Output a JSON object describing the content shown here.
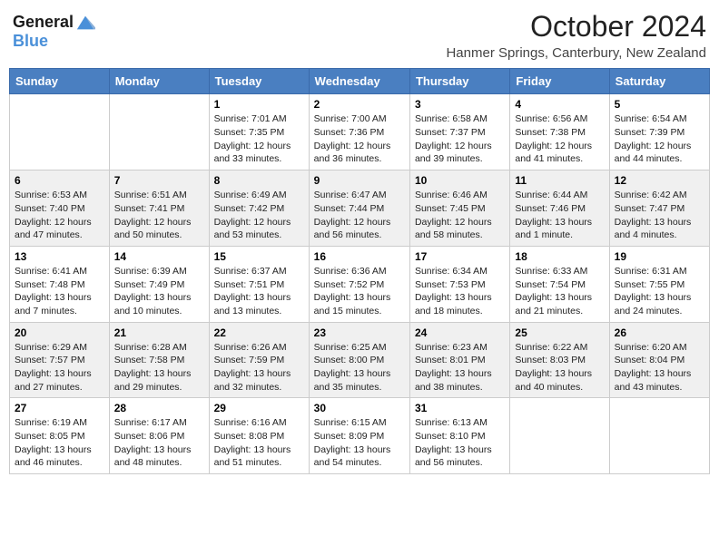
{
  "logo": {
    "general": "General",
    "blue": "Blue"
  },
  "title": "October 2024",
  "subtitle": "Hanmer Springs, Canterbury, New Zealand",
  "days_of_week": [
    "Sunday",
    "Monday",
    "Tuesday",
    "Wednesday",
    "Thursday",
    "Friday",
    "Saturday"
  ],
  "weeks": [
    [
      {
        "day": "",
        "sunrise": "",
        "sunset": "",
        "daylight": ""
      },
      {
        "day": "",
        "sunrise": "",
        "sunset": "",
        "daylight": ""
      },
      {
        "day": "1",
        "sunrise": "Sunrise: 7:01 AM",
        "sunset": "Sunset: 7:35 PM",
        "daylight": "Daylight: 12 hours and 33 minutes."
      },
      {
        "day": "2",
        "sunrise": "Sunrise: 7:00 AM",
        "sunset": "Sunset: 7:36 PM",
        "daylight": "Daylight: 12 hours and 36 minutes."
      },
      {
        "day": "3",
        "sunrise": "Sunrise: 6:58 AM",
        "sunset": "Sunset: 7:37 PM",
        "daylight": "Daylight: 12 hours and 39 minutes."
      },
      {
        "day": "4",
        "sunrise": "Sunrise: 6:56 AM",
        "sunset": "Sunset: 7:38 PM",
        "daylight": "Daylight: 12 hours and 41 minutes."
      },
      {
        "day": "5",
        "sunrise": "Sunrise: 6:54 AM",
        "sunset": "Sunset: 7:39 PM",
        "daylight": "Daylight: 12 hours and 44 minutes."
      }
    ],
    [
      {
        "day": "6",
        "sunrise": "Sunrise: 6:53 AM",
        "sunset": "Sunset: 7:40 PM",
        "daylight": "Daylight: 12 hours and 47 minutes."
      },
      {
        "day": "7",
        "sunrise": "Sunrise: 6:51 AM",
        "sunset": "Sunset: 7:41 PM",
        "daylight": "Daylight: 12 hours and 50 minutes."
      },
      {
        "day": "8",
        "sunrise": "Sunrise: 6:49 AM",
        "sunset": "Sunset: 7:42 PM",
        "daylight": "Daylight: 12 hours and 53 minutes."
      },
      {
        "day": "9",
        "sunrise": "Sunrise: 6:47 AM",
        "sunset": "Sunset: 7:44 PM",
        "daylight": "Daylight: 12 hours and 56 minutes."
      },
      {
        "day": "10",
        "sunrise": "Sunrise: 6:46 AM",
        "sunset": "Sunset: 7:45 PM",
        "daylight": "Daylight: 12 hours and 58 minutes."
      },
      {
        "day": "11",
        "sunrise": "Sunrise: 6:44 AM",
        "sunset": "Sunset: 7:46 PM",
        "daylight": "Daylight: 13 hours and 1 minute."
      },
      {
        "day": "12",
        "sunrise": "Sunrise: 6:42 AM",
        "sunset": "Sunset: 7:47 PM",
        "daylight": "Daylight: 13 hours and 4 minutes."
      }
    ],
    [
      {
        "day": "13",
        "sunrise": "Sunrise: 6:41 AM",
        "sunset": "Sunset: 7:48 PM",
        "daylight": "Daylight: 13 hours and 7 minutes."
      },
      {
        "day": "14",
        "sunrise": "Sunrise: 6:39 AM",
        "sunset": "Sunset: 7:49 PM",
        "daylight": "Daylight: 13 hours and 10 minutes."
      },
      {
        "day": "15",
        "sunrise": "Sunrise: 6:37 AM",
        "sunset": "Sunset: 7:51 PM",
        "daylight": "Daylight: 13 hours and 13 minutes."
      },
      {
        "day": "16",
        "sunrise": "Sunrise: 6:36 AM",
        "sunset": "Sunset: 7:52 PM",
        "daylight": "Daylight: 13 hours and 15 minutes."
      },
      {
        "day": "17",
        "sunrise": "Sunrise: 6:34 AM",
        "sunset": "Sunset: 7:53 PM",
        "daylight": "Daylight: 13 hours and 18 minutes."
      },
      {
        "day": "18",
        "sunrise": "Sunrise: 6:33 AM",
        "sunset": "Sunset: 7:54 PM",
        "daylight": "Daylight: 13 hours and 21 minutes."
      },
      {
        "day": "19",
        "sunrise": "Sunrise: 6:31 AM",
        "sunset": "Sunset: 7:55 PM",
        "daylight": "Daylight: 13 hours and 24 minutes."
      }
    ],
    [
      {
        "day": "20",
        "sunrise": "Sunrise: 6:29 AM",
        "sunset": "Sunset: 7:57 PM",
        "daylight": "Daylight: 13 hours and 27 minutes."
      },
      {
        "day": "21",
        "sunrise": "Sunrise: 6:28 AM",
        "sunset": "Sunset: 7:58 PM",
        "daylight": "Daylight: 13 hours and 29 minutes."
      },
      {
        "day": "22",
        "sunrise": "Sunrise: 6:26 AM",
        "sunset": "Sunset: 7:59 PM",
        "daylight": "Daylight: 13 hours and 32 minutes."
      },
      {
        "day": "23",
        "sunrise": "Sunrise: 6:25 AM",
        "sunset": "Sunset: 8:00 PM",
        "daylight": "Daylight: 13 hours and 35 minutes."
      },
      {
        "day": "24",
        "sunrise": "Sunrise: 6:23 AM",
        "sunset": "Sunset: 8:01 PM",
        "daylight": "Daylight: 13 hours and 38 minutes."
      },
      {
        "day": "25",
        "sunrise": "Sunrise: 6:22 AM",
        "sunset": "Sunset: 8:03 PM",
        "daylight": "Daylight: 13 hours and 40 minutes."
      },
      {
        "day": "26",
        "sunrise": "Sunrise: 6:20 AM",
        "sunset": "Sunset: 8:04 PM",
        "daylight": "Daylight: 13 hours and 43 minutes."
      }
    ],
    [
      {
        "day": "27",
        "sunrise": "Sunrise: 6:19 AM",
        "sunset": "Sunset: 8:05 PM",
        "daylight": "Daylight: 13 hours and 46 minutes."
      },
      {
        "day": "28",
        "sunrise": "Sunrise: 6:17 AM",
        "sunset": "Sunset: 8:06 PM",
        "daylight": "Daylight: 13 hours and 48 minutes."
      },
      {
        "day": "29",
        "sunrise": "Sunrise: 6:16 AM",
        "sunset": "Sunset: 8:08 PM",
        "daylight": "Daylight: 13 hours and 51 minutes."
      },
      {
        "day": "30",
        "sunrise": "Sunrise: 6:15 AM",
        "sunset": "Sunset: 8:09 PM",
        "daylight": "Daylight: 13 hours and 54 minutes."
      },
      {
        "day": "31",
        "sunrise": "Sunrise: 6:13 AM",
        "sunset": "Sunset: 8:10 PM",
        "daylight": "Daylight: 13 hours and 56 minutes."
      },
      {
        "day": "",
        "sunrise": "",
        "sunset": "",
        "daylight": ""
      },
      {
        "day": "",
        "sunrise": "",
        "sunset": "",
        "daylight": ""
      }
    ]
  ]
}
